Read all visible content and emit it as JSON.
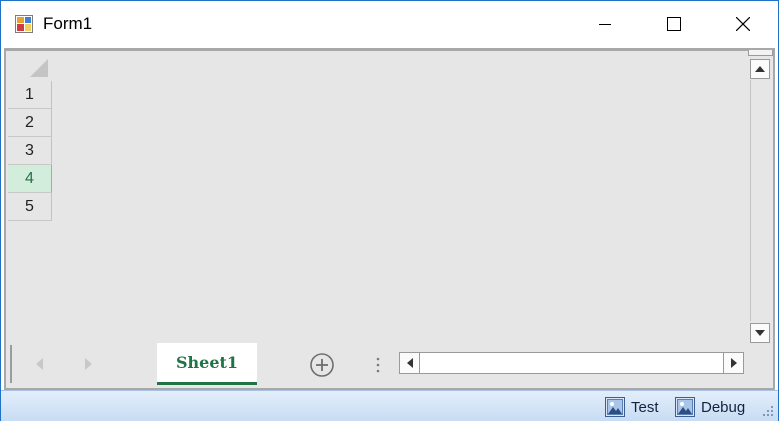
{
  "window": {
    "title": "Form1",
    "minimize_label": "Minimize",
    "maximize_label": "Maximize",
    "close_label": "Close"
  },
  "grid": {
    "rows": [
      "1",
      "2",
      "3",
      "4",
      "5"
    ],
    "selected_row": "4"
  },
  "sheets": {
    "tabs": [
      {
        "label": "Sheet1",
        "active": true
      }
    ]
  },
  "statusbar": {
    "items": [
      {
        "label": "Test",
        "icon": "image-icon"
      },
      {
        "label": "Debug",
        "icon": "image-icon"
      }
    ]
  },
  "colors": {
    "accent_green": "#217346",
    "selected_row_bg": "#d2eddb",
    "window_border": "#1e73c9",
    "statusbar_bg": "#c8dcf3"
  }
}
